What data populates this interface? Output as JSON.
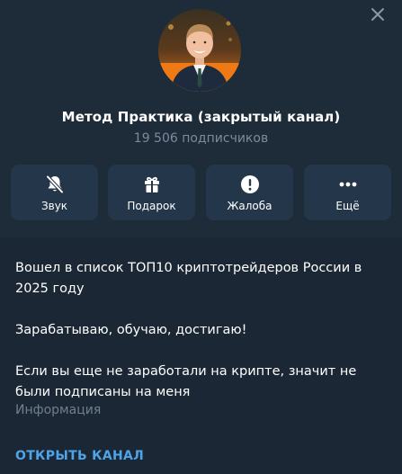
{
  "channel": {
    "title": "Метод Практика (закрытый канал)",
    "subscribers": "19 506 подписчиков"
  },
  "actions": [
    {
      "label": "Звук",
      "icon": "bell-muted-icon"
    },
    {
      "label": "Подарок",
      "icon": "gift-icon"
    },
    {
      "label": "Жалоба",
      "icon": "warning-icon"
    },
    {
      "label": "Ещё",
      "icon": "more-dots-icon"
    }
  ],
  "info": {
    "description": "Вошел в список ТОП10 криптотрейдеров России в 2025 году\n\nЗарабатываю, обучаю, достигаю!\n\nЕсли вы еще не заработали на крипте, значит не были подписаны на меня",
    "label": "Информация"
  },
  "open_channel_label": "ОТКРЫТЬ КАНАЛ",
  "colors": {
    "background": "#1e2c3a",
    "button_bg": "#24364a",
    "accent": "#4ea4e8",
    "muted_text": "#7b8b9b"
  }
}
